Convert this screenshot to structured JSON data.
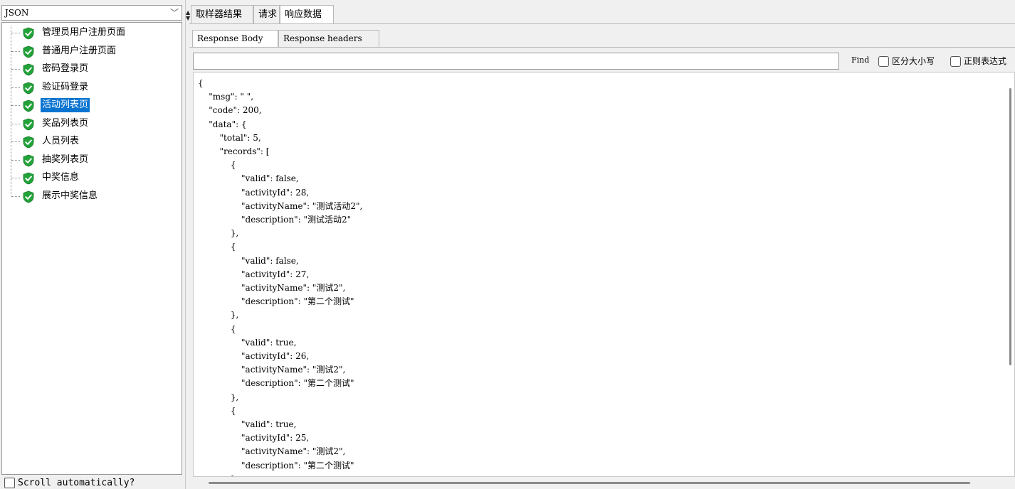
{
  "left_panel": {
    "renderer_select": "JSON",
    "tree_items": [
      {
        "label": "管理员用户注册页面",
        "selected": false
      },
      {
        "label": "普通用户注册页面",
        "selected": false
      },
      {
        "label": "密码登录页",
        "selected": false
      },
      {
        "label": "验证码登录",
        "selected": false
      },
      {
        "label": "活动列表页",
        "selected": true
      },
      {
        "label": "奖品列表页",
        "selected": false
      },
      {
        "label": "人员列表",
        "selected": false
      },
      {
        "label": "抽奖列表页",
        "selected": false
      },
      {
        "label": "中奖信息",
        "selected": false
      },
      {
        "label": "展示中奖信息",
        "selected": false
      }
    ],
    "scroll_automatically_label": "Scroll automatically?"
  },
  "main_tabs": [
    {
      "label": "取样器结果",
      "active": false
    },
    {
      "label": "请求",
      "active": false
    },
    {
      "label": "响应数据",
      "active": true
    }
  ],
  "sub_tabs": [
    {
      "label": "Response Body",
      "active": true
    },
    {
      "label": "Response headers",
      "active": false
    }
  ],
  "find": {
    "label": "Find",
    "value": "",
    "case_sensitive_label": "区分大小写",
    "regex_label": "正则表达式"
  },
  "response_body": "{\n    \"msg\": \" \",\n    \"code\": 200,\n    \"data\": {\n        \"total\": 5,\n        \"records\": [\n            {\n                \"valid\": false,\n                \"activityId\": 28,\n                \"activityName\": \"测试活动2\",\n                \"description\": \"测试活动2\"\n            },\n            {\n                \"valid\": false,\n                \"activityId\": 27,\n                \"activityName\": \"测试2\",\n                \"description\": \"第二个测试\"\n            },\n            {\n                \"valid\": true,\n                \"activityId\": 26,\n                \"activityName\": \"测试2\",\n                \"description\": \"第二个测试\"\n            },\n            {\n                \"valid\": true,\n                \"activityId\": 25,\n                \"activityName\": \"测试2\",\n                \"description\": \"第二个测试\"\n            }",
  "colors": {
    "selection": "#0b74d0",
    "shield_green": "#22a33a"
  }
}
